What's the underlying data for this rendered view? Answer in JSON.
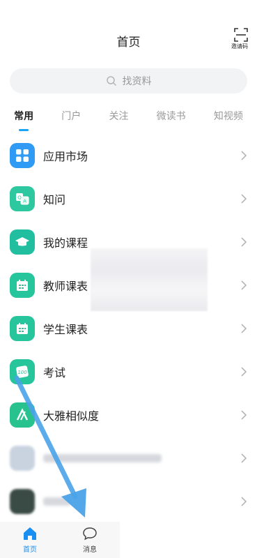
{
  "header": {
    "title": "首页",
    "invite_label": "邀请码"
  },
  "search": {
    "placeholder": "找资料"
  },
  "tabs": [
    {
      "label": "常用",
      "active": true
    },
    {
      "label": "门户"
    },
    {
      "label": "关注"
    },
    {
      "label": "微读书"
    },
    {
      "label": "知视频"
    }
  ],
  "list": [
    {
      "label": "应用市场",
      "icon": "grid-icon",
      "color": "#2f9bf5"
    },
    {
      "label": "知问",
      "icon": "qa-icon",
      "color": "#2ec8a0"
    },
    {
      "label": "我的课程",
      "icon": "graduation-cap-icon",
      "color": "#21bfa0"
    },
    {
      "label": "教师课表",
      "icon": "calendar-icon",
      "color": "#26c59b"
    },
    {
      "label": "学生课表",
      "icon": "calendar-icon",
      "color": "#26c59b"
    },
    {
      "label": "考试",
      "icon": "exam-100-icon",
      "color": "#26c59b"
    },
    {
      "label": "大雅相似度",
      "icon": "daya-icon",
      "color": "#28c28f"
    }
  ],
  "bottom_nav": [
    {
      "label": "首页",
      "active": true,
      "color": "#1a8ff0"
    },
    {
      "label": "消息",
      "active": false
    }
  ],
  "colors": {
    "accent": "#1aa3f7",
    "arrow": "#4ba3e8"
  }
}
